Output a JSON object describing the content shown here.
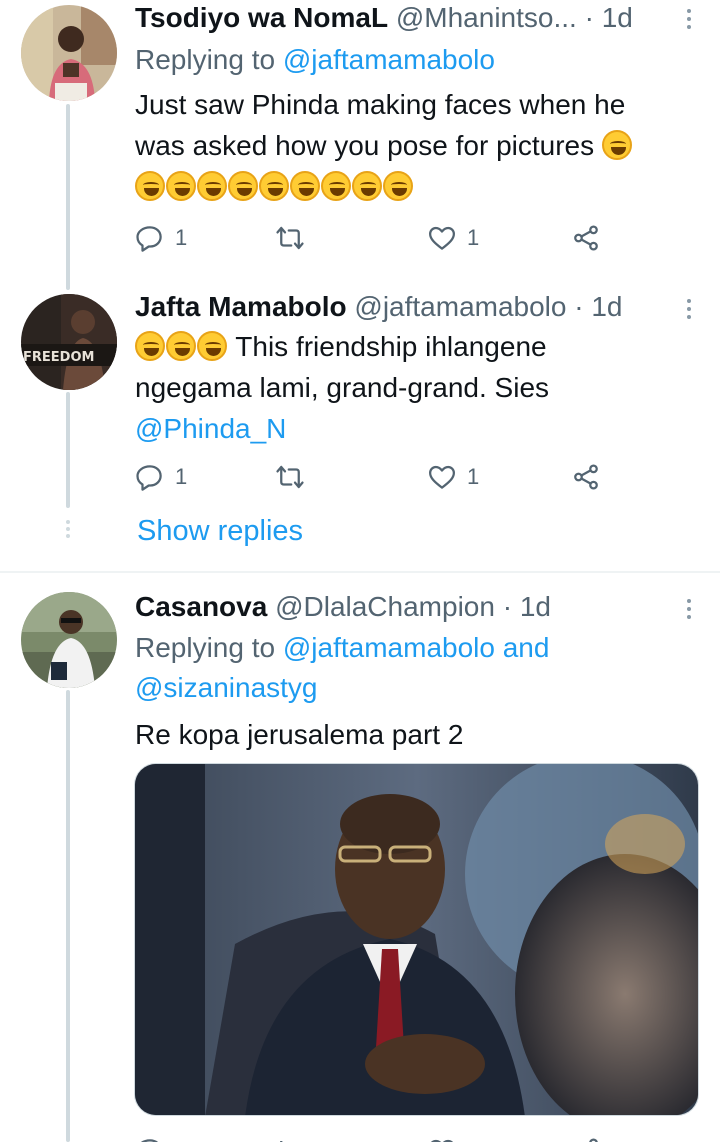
{
  "tweets": [
    {
      "name": "Tsodiyo wa NomaL",
      "handle": "@Mhanintso...",
      "time": "· 1d",
      "replying_prefix": "Replying to",
      "replying_mentions": "@jaftamamabolo",
      "text_line1": "Just saw Phinda making faces when he",
      "text_line2": "was asked how you pose for pictures",
      "emoji_row_count": 9,
      "reply_count": "1",
      "like_count": "1"
    },
    {
      "name": "Jafta Mamabolo",
      "handle": "@jaftamamabolo",
      "time": "· 1d",
      "avatar_text": "FREEDOM",
      "text_line1": "This friendship ihlangene",
      "text_line2": "ngegama lami, grand-grand. Sies",
      "mention": "@Phinda_N",
      "reply_count": "1",
      "like_count": "1",
      "show_replies": "Show replies"
    },
    {
      "name": "Casanova",
      "handle": "@DlalaChampion",
      "time": "· 1d",
      "replying_prefix": "Replying to",
      "replying_mentions_line1": "@jaftamamabolo and",
      "replying_mentions_line2": "@sizaninastyg",
      "text": "Re kopa jerusalema part 2",
      "media": "photo"
    }
  ],
  "icons": [
    "reply-icon",
    "retweet-icon",
    "like-icon",
    "share-icon",
    "more-icon"
  ],
  "colors": {
    "accent": "#1d9bf0",
    "secondary_text": "#536471",
    "thread_line": "#cfd9de"
  }
}
